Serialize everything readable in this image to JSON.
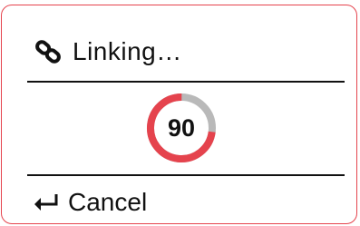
{
  "dialog": {
    "title": "Linking…",
    "title_icon": "link-icon",
    "progress": {
      "value": 90,
      "percent": 0.73,
      "accent_color": "#e5434d",
      "track_color": "#b9b9b9"
    },
    "cancel": {
      "label": "Cancel",
      "icon": "enter-icon"
    },
    "border_color": "#e5434d"
  }
}
